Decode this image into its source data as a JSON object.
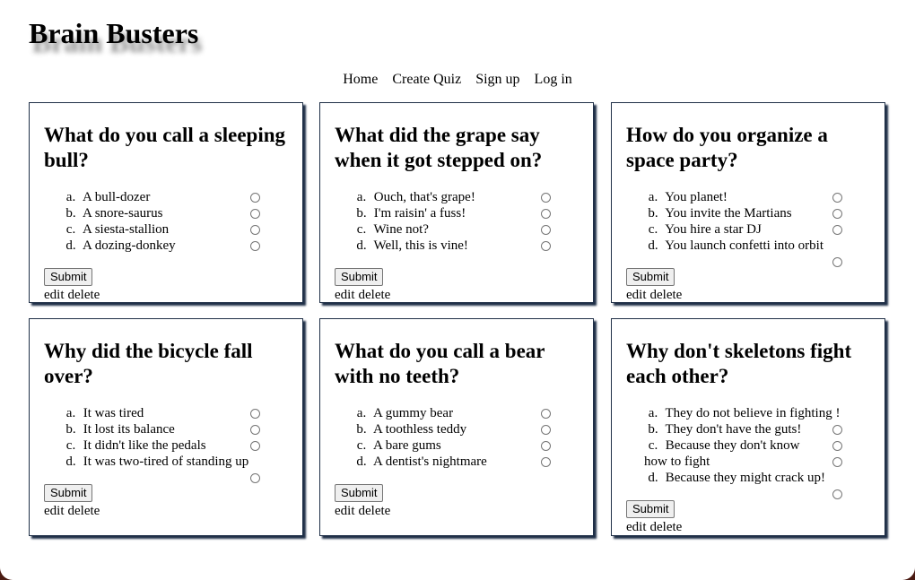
{
  "site": {
    "title": "Brain Busters"
  },
  "nav": {
    "home": "Home",
    "create": "Create Quiz",
    "signup": "Sign up",
    "login": "Log in"
  },
  "cards": [
    {
      "question": "What do you call a sleeping bull?",
      "answers": [
        {
          "marker": "a.",
          "text": "A bull-dozer"
        },
        {
          "marker": "b.",
          "text": "A snore-saurus"
        },
        {
          "marker": "c.",
          "text": "A siesta-stallion"
        },
        {
          "marker": "d.",
          "text": "A dozing-donkey"
        }
      ],
      "submit": "Submit",
      "edit": "edit",
      "delete": "delete"
    },
    {
      "question": "What did the grape say when it got stepped on?",
      "answers": [
        {
          "marker": "a.",
          "text": "Ouch, that's grape!"
        },
        {
          "marker": "b.",
          "text": "I'm raisin' a fuss!"
        },
        {
          "marker": "c.",
          "text": "Wine not?"
        },
        {
          "marker": "d.",
          "text": "Well, this is vine!"
        }
      ],
      "submit": "Submit",
      "edit": "edit",
      "delete": "delete"
    },
    {
      "question": "How do you organize a space party?",
      "answers": [
        {
          "marker": "a.",
          "text": "You planet!"
        },
        {
          "marker": "b.",
          "text": "You invite the Martians"
        },
        {
          "marker": "c.",
          "text": "You hire a star DJ"
        },
        {
          "marker": "d.",
          "text": "You launch confetti into orbit"
        }
      ],
      "submit": "Submit",
      "edit": "edit",
      "delete": "delete"
    },
    {
      "question": "Why did the bicycle fall over?",
      "answers": [
        {
          "marker": "a.",
          "text": "It was tired"
        },
        {
          "marker": "b.",
          "text": "It lost its balance"
        },
        {
          "marker": "c.",
          "text": "It didn't like the pedals"
        },
        {
          "marker": "d.",
          "text": "It was two-tired of standing up"
        }
      ],
      "submit": "Submit",
      "edit": "edit",
      "delete": "delete"
    },
    {
      "question": "What do you call a bear with no teeth?",
      "answers": [
        {
          "marker": "a.",
          "text": "A gummy bear"
        },
        {
          "marker": "b.",
          "text": "A toothless teddy"
        },
        {
          "marker": "c.",
          "text": "A bare gums"
        },
        {
          "marker": "d.",
          "text": "A dentist's nightmare"
        }
      ],
      "submit": "Submit",
      "edit": "edit",
      "delete": "delete"
    },
    {
      "question": "Why don't skeletons fight each other?",
      "answers": [
        {
          "marker": "a.",
          "text": "They do not believe in fighting !"
        },
        {
          "marker": "b.",
          "text": "They don't have the guts!"
        },
        {
          "marker": "c.",
          "text": "Because they don't know how to fight"
        },
        {
          "marker": "d.",
          "text": "Because they might crack up!"
        }
      ],
      "submit": "Submit",
      "edit": "edit",
      "delete": "delete"
    }
  ]
}
